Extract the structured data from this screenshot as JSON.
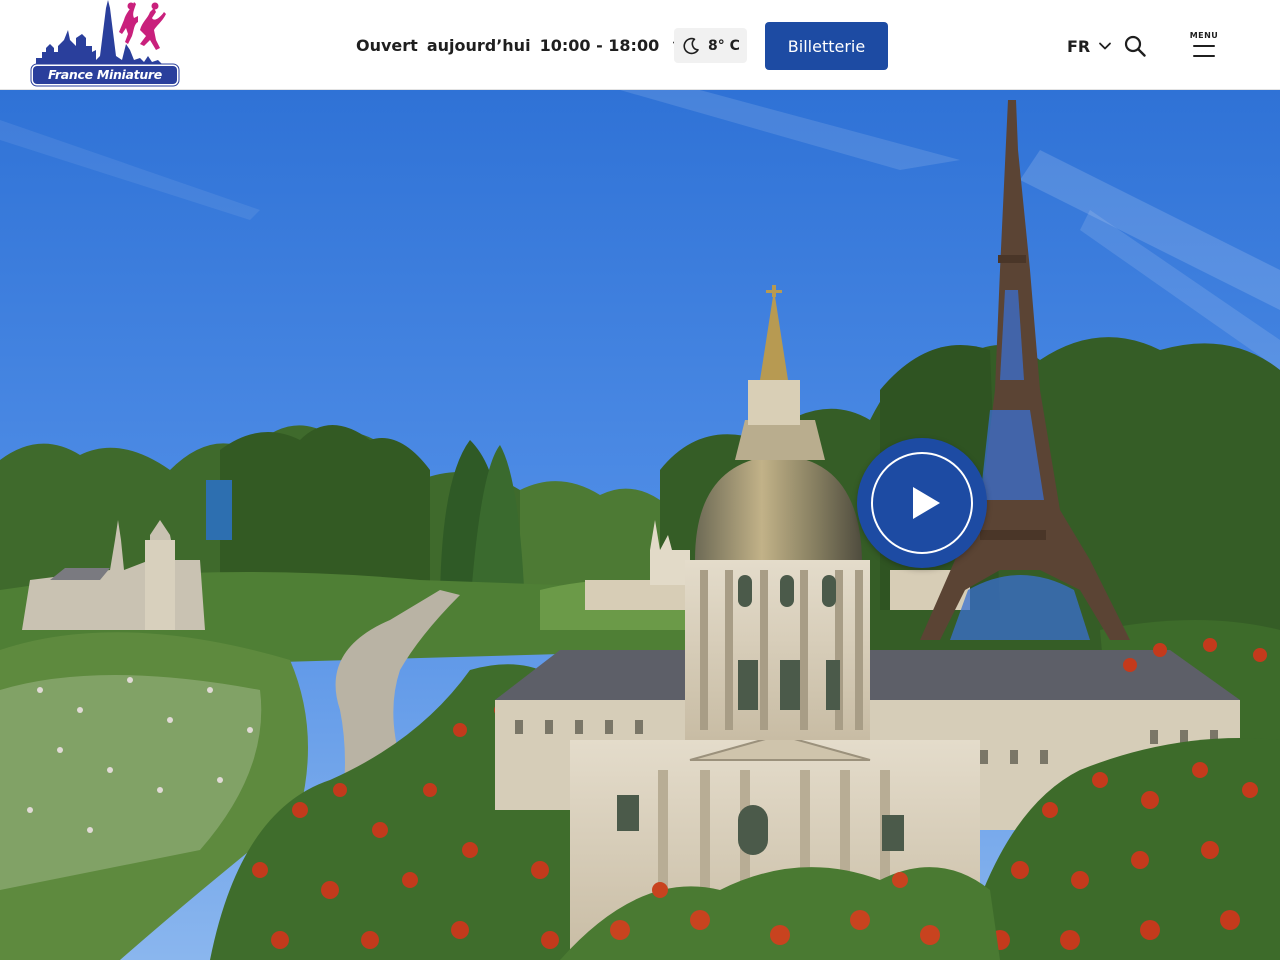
{
  "header": {
    "logo_text": "France Miniature",
    "hours": {
      "status": "Ouvert",
      "day": "aujourd’hui",
      "time": "10:00 - 18:00"
    },
    "weather": {
      "temperature": "8° C",
      "icon": "moon-icon"
    },
    "ticket_label": "Billetterie",
    "language": "FR",
    "menu_label": "MENU"
  },
  "hero": {
    "play_icon": "play-icon",
    "image_alt": "Miniature park with Les Invalides dome and Eiffel Tower replicas among flowers"
  },
  "colors": {
    "brand_blue": "#1d4ba3",
    "logo_magenta": "#c9207c",
    "logo_navy": "#2a3f9c"
  }
}
